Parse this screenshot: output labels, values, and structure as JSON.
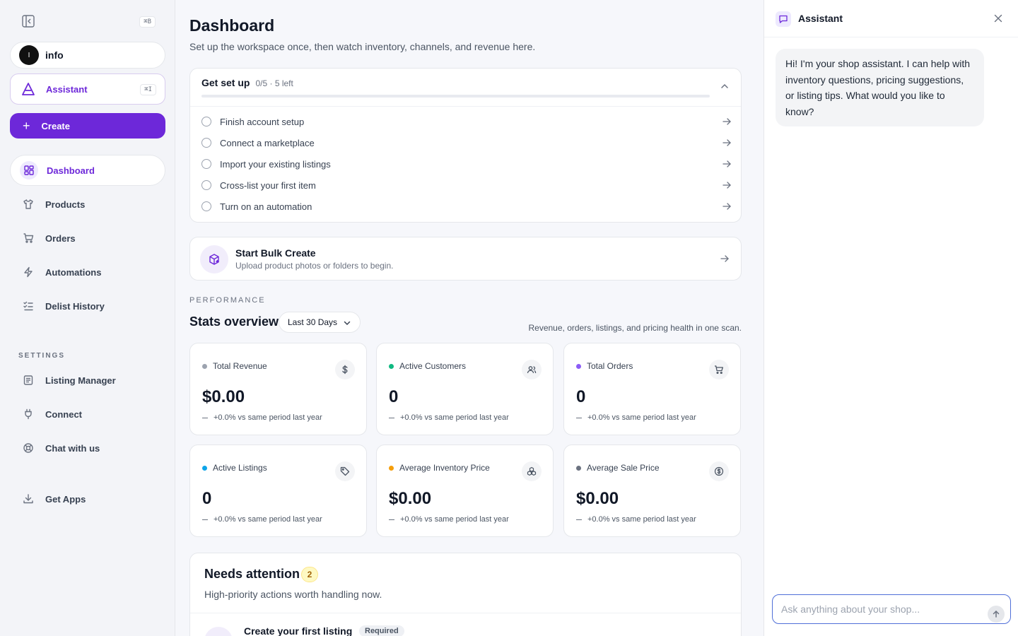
{
  "sidebar": {
    "collapse_shortcut": "⌘B",
    "workspace": {
      "avatar": "I",
      "name": "info"
    },
    "assistant": {
      "label": "Assistant",
      "shortcut": "⌘I"
    },
    "create_label": "Create",
    "nav": [
      {
        "label": "Dashboard",
        "icon": "grid-icon",
        "active": true
      },
      {
        "label": "Products",
        "icon": "shirt-icon"
      },
      {
        "label": "Orders",
        "icon": "cart-icon"
      },
      {
        "label": "Automations",
        "icon": "bolt-icon"
      },
      {
        "label": "Delist History",
        "icon": "list-check-icon"
      }
    ],
    "settings_label": "SETTINGS",
    "settings": [
      {
        "label": "Listing Manager",
        "icon": "document-icon"
      },
      {
        "label": "Connect",
        "icon": "plug-icon"
      },
      {
        "label": "Chat with us",
        "icon": "lifebuoy-icon"
      }
    ],
    "get_apps": {
      "label": "Get Apps",
      "icon": "download-icon"
    }
  },
  "main": {
    "title": "Dashboard",
    "subtitle": "Set up the workspace once, then watch inventory, channels, and revenue here.",
    "setup": {
      "title": "Get set up",
      "progress_text": "0/5 · 5 left",
      "progress_fraction": 0,
      "tasks": [
        "Finish account setup",
        "Connect a marketplace",
        "Import your existing listings",
        "Cross-list your first item",
        "Turn on an automation"
      ]
    },
    "bulk": {
      "title": "Start Bulk Create",
      "subtitle": "Upload product photos or folders to begin."
    },
    "performance_label": "PERFORMANCE",
    "stats_title": "Stats overview",
    "range": "Last 30 Days",
    "stats_desc": "Revenue, orders, listings, and pricing health in one scan.",
    "stats": [
      {
        "label": "Total Revenue",
        "value": "$0.00",
        "change": "+0.0% vs same period last year",
        "dot_color": "#9ca3af",
        "icon": "dollar-icon"
      },
      {
        "label": "Active Customers",
        "value": "0",
        "change": "+0.0% vs same period last year",
        "dot_color": "#10b981",
        "icon": "users-icon"
      },
      {
        "label": "Total Orders",
        "value": "0",
        "change": "+0.0% vs same period last year",
        "dot_color": "#8b5cf6",
        "icon": "cart-icon"
      },
      {
        "label": "Active Listings",
        "value": "0",
        "change": "+0.0% vs same period last year",
        "dot_color": "#0ea5e9",
        "icon": "tag-icon"
      },
      {
        "label": "Average Inventory Price",
        "value": "$0.00",
        "change": "+0.0% vs same period last year",
        "dot_color": "#f59e0b",
        "icon": "boxes-icon"
      },
      {
        "label": "Average Sale Price",
        "value": "$0.00",
        "change": "+0.0% vs same period last year",
        "dot_color": "#6b7280",
        "icon": "coin-icon"
      }
    ],
    "attention": {
      "title": "Needs attention",
      "count": "2",
      "subtitle": "High-priority actions worth handling now.",
      "first_item": {
        "title": "Create your first listing",
        "badge": "Required"
      }
    }
  },
  "assistant_panel": {
    "title": "Assistant",
    "message": "Hi! I'm your shop assistant. I can help with inventory questions, pricing suggestions, or listing tips. What would you like to know?",
    "input_placeholder": "Ask anything about your shop..."
  },
  "colors": {
    "accent": "#6d28d9",
    "input_focus": "#4f6fd8"
  }
}
